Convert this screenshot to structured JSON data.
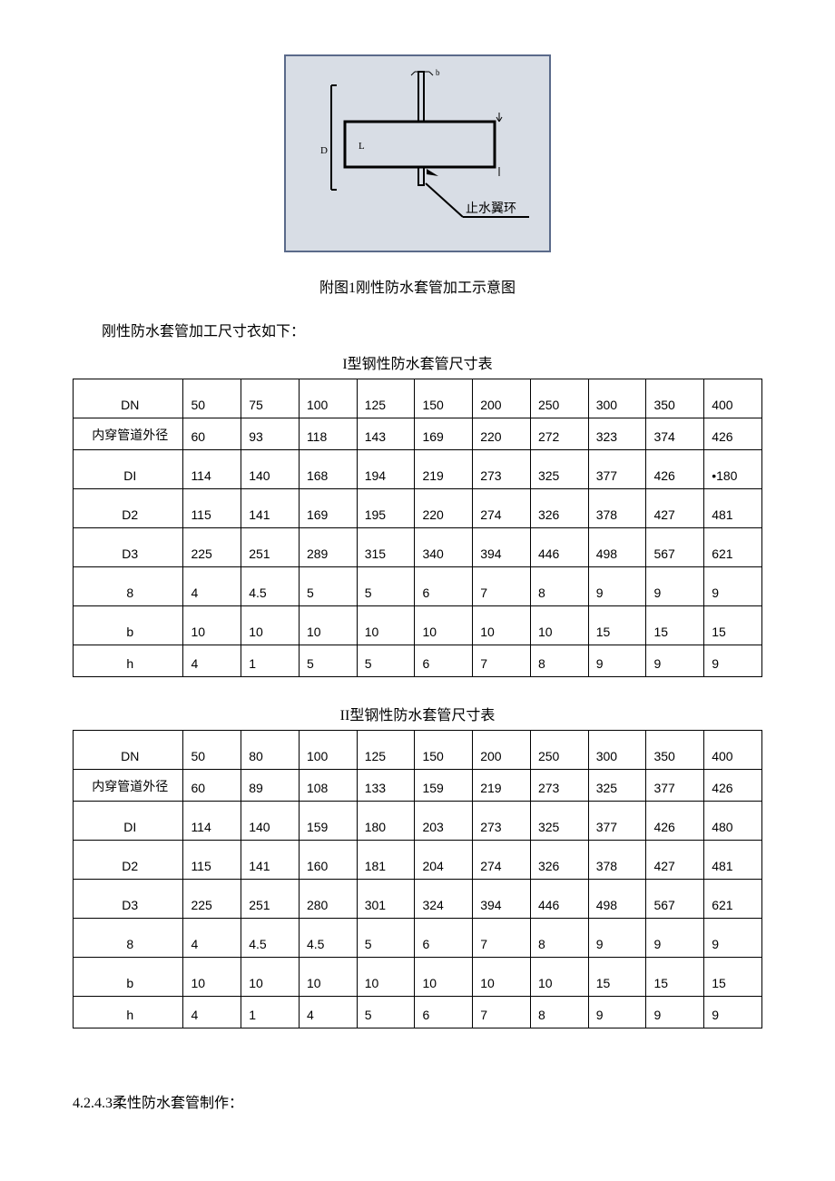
{
  "figure": {
    "caption": "附图1刚性防水套管加工示意图",
    "ring_label": "止水翼环",
    "dim_b": "b",
    "dim_D": "D",
    "dim_L": "L"
  },
  "intro": "刚性防水套管加工尺寸衣如下：",
  "section_next": "4.2.4.3柔性防水套管制作：",
  "table1": {
    "title": "I型钢性防水套管尺寸表",
    "labels": [
      "DN",
      "内穿管道外径",
      "DI",
      "D2",
      "D3",
      "8",
      "b",
      "h"
    ],
    "cols": [
      [
        "50",
        "60",
        "114",
        "115",
        "225",
        "4",
        "10",
        "4"
      ],
      [
        "75",
        "93",
        "140",
        "141",
        "251",
        "4.5",
        "10",
        "1"
      ],
      [
        "100",
        "118",
        "168",
        "169",
        "289",
        "5",
        "10",
        "5"
      ],
      [
        "125",
        "143",
        "194",
        "195",
        "315",
        "5",
        "10",
        "5"
      ],
      [
        "150",
        "169",
        "219",
        "220",
        "340",
        "6",
        "10",
        "6"
      ],
      [
        "200",
        "220",
        "273",
        "274",
        "394",
        "7",
        "10",
        "7"
      ],
      [
        "250",
        "272",
        "325",
        "326",
        "446",
        "8",
        "10",
        "8"
      ],
      [
        "300",
        "323",
        "377",
        "378",
        "498",
        "9",
        "15",
        "9"
      ],
      [
        "350",
        "374",
        "426",
        "427",
        "567",
        "9",
        "15",
        "9"
      ],
      [
        "400",
        "426",
        "•180",
        "481",
        "621",
        "9",
        "15",
        "9"
      ]
    ]
  },
  "table2": {
    "title": "II型钢性防水套管尺寸表",
    "labels": [
      "DN",
      "内穿管道外径",
      "DI",
      "D2",
      "D3",
      "8",
      "b",
      "h"
    ],
    "cols": [
      [
        "50",
        "60",
        "114",
        "115",
        "225",
        "4",
        "10",
        "4"
      ],
      [
        "80",
        "89",
        "140",
        "141",
        "251",
        "4.5",
        "10",
        "1"
      ],
      [
        "100",
        "108",
        "159",
        "160",
        "280",
        "4.5",
        "10",
        "4"
      ],
      [
        "125",
        "133",
        "180",
        "181",
        "301",
        "5",
        "10",
        "5"
      ],
      [
        "150",
        "159",
        "203",
        "204",
        "324",
        "6",
        "10",
        "6"
      ],
      [
        "200",
        "219",
        "273",
        "274",
        "394",
        "7",
        "10",
        "7"
      ],
      [
        "250",
        "273",
        "325",
        "326",
        "446",
        "8",
        "10",
        "8"
      ],
      [
        "300",
        "325",
        "377",
        "378",
        "498",
        "9",
        "15",
        "9"
      ],
      [
        "350",
        "377",
        "426",
        "427",
        "567",
        "9",
        "15",
        "9"
      ],
      [
        "400",
        "426",
        "480",
        "481",
        "621",
        "9",
        "15",
        "9"
      ]
    ]
  },
  "chart_data": {
    "type": "table",
    "tables": [
      {
        "title": "I型钢性防水套管尺寸表",
        "row_labels": [
          "DN",
          "内穿管道外径",
          "DI",
          "D2",
          "D3",
          "8",
          "b",
          "h"
        ],
        "columns": [
          {
            "DN": 50,
            "内穿管道外径": 60,
            "DI": 114,
            "D2": 115,
            "D3": 225,
            "8": 4,
            "b": 10,
            "h": 4
          },
          {
            "DN": 75,
            "内穿管道外径": 93,
            "DI": 140,
            "D2": 141,
            "D3": 251,
            "8": 4.5,
            "b": 10,
            "h": 1
          },
          {
            "DN": 100,
            "内穿管道外径": 118,
            "DI": 168,
            "D2": 169,
            "D3": 289,
            "8": 5,
            "b": 10,
            "h": 5
          },
          {
            "DN": 125,
            "内穿管道外径": 143,
            "DI": 194,
            "D2": 195,
            "D3": 315,
            "8": 5,
            "b": 10,
            "h": 5
          },
          {
            "DN": 150,
            "内穿管道外径": 169,
            "DI": 219,
            "D2": 220,
            "D3": 340,
            "8": 6,
            "b": 10,
            "h": 6
          },
          {
            "DN": 200,
            "内穿管道外径": 220,
            "DI": 273,
            "D2": 274,
            "D3": 394,
            "8": 7,
            "b": 10,
            "h": 7
          },
          {
            "DN": 250,
            "内穿管道外径": 272,
            "DI": 325,
            "D2": 326,
            "D3": 446,
            "8": 8,
            "b": 10,
            "h": 8
          },
          {
            "DN": 300,
            "内穿管道外径": 323,
            "DI": 377,
            "D2": 378,
            "D3": 498,
            "8": 9,
            "b": 15,
            "h": 9
          },
          {
            "DN": 350,
            "内穿管道外径": 374,
            "DI": 426,
            "D2": 427,
            "D3": 567,
            "8": 9,
            "b": 15,
            "h": 9
          },
          {
            "DN": 400,
            "内穿管道外径": 426,
            "DI": "•180",
            "D2": 481,
            "D3": 621,
            "8": 9,
            "b": 15,
            "h": 9
          }
        ]
      },
      {
        "title": "II型钢性防水套管尺寸表",
        "row_labels": [
          "DN",
          "内穿管道外径",
          "DI",
          "D2",
          "D3",
          "8",
          "b",
          "h"
        ],
        "columns": [
          {
            "DN": 50,
            "内穿管道外径": 60,
            "DI": 114,
            "D2": 115,
            "D3": 225,
            "8": 4,
            "b": 10,
            "h": 4
          },
          {
            "DN": 80,
            "内穿管道外径": 89,
            "DI": 140,
            "D2": 141,
            "D3": 251,
            "8": 4.5,
            "b": 10,
            "h": 1
          },
          {
            "DN": 100,
            "内穿管道外径": 108,
            "DI": 159,
            "D2": 160,
            "D3": 280,
            "8": 4.5,
            "b": 10,
            "h": 4
          },
          {
            "DN": 125,
            "内穿管道外径": 133,
            "DI": 180,
            "D2": 181,
            "D3": 301,
            "8": 5,
            "b": 10,
            "h": 5
          },
          {
            "DN": 150,
            "内穿管道外径": 159,
            "DI": 203,
            "D2": 204,
            "D3": 324,
            "8": 6,
            "b": 10,
            "h": 6
          },
          {
            "DN": 200,
            "内穿管道外径": 219,
            "DI": 273,
            "D2": 274,
            "D3": 394,
            "8": 7,
            "b": 10,
            "h": 7
          },
          {
            "DN": 250,
            "内穿管道外径": 273,
            "DI": 325,
            "D2": 326,
            "D3": 446,
            "8": 8,
            "b": 10,
            "h": 8
          },
          {
            "DN": 300,
            "内穿管道外径": 325,
            "DI": 377,
            "D2": 378,
            "D3": 498,
            "8": 9,
            "b": 15,
            "h": 9
          },
          {
            "DN": 350,
            "内穿管道外径": 377,
            "DI": 426,
            "D2": 427,
            "D3": 567,
            "8": 9,
            "b": 15,
            "h": 9
          },
          {
            "DN": 400,
            "内穿管道外径": 426,
            "DI": 480,
            "D2": 481,
            "D3": 621,
            "8": 9,
            "b": 15,
            "h": 9
          }
        ]
      }
    ]
  }
}
